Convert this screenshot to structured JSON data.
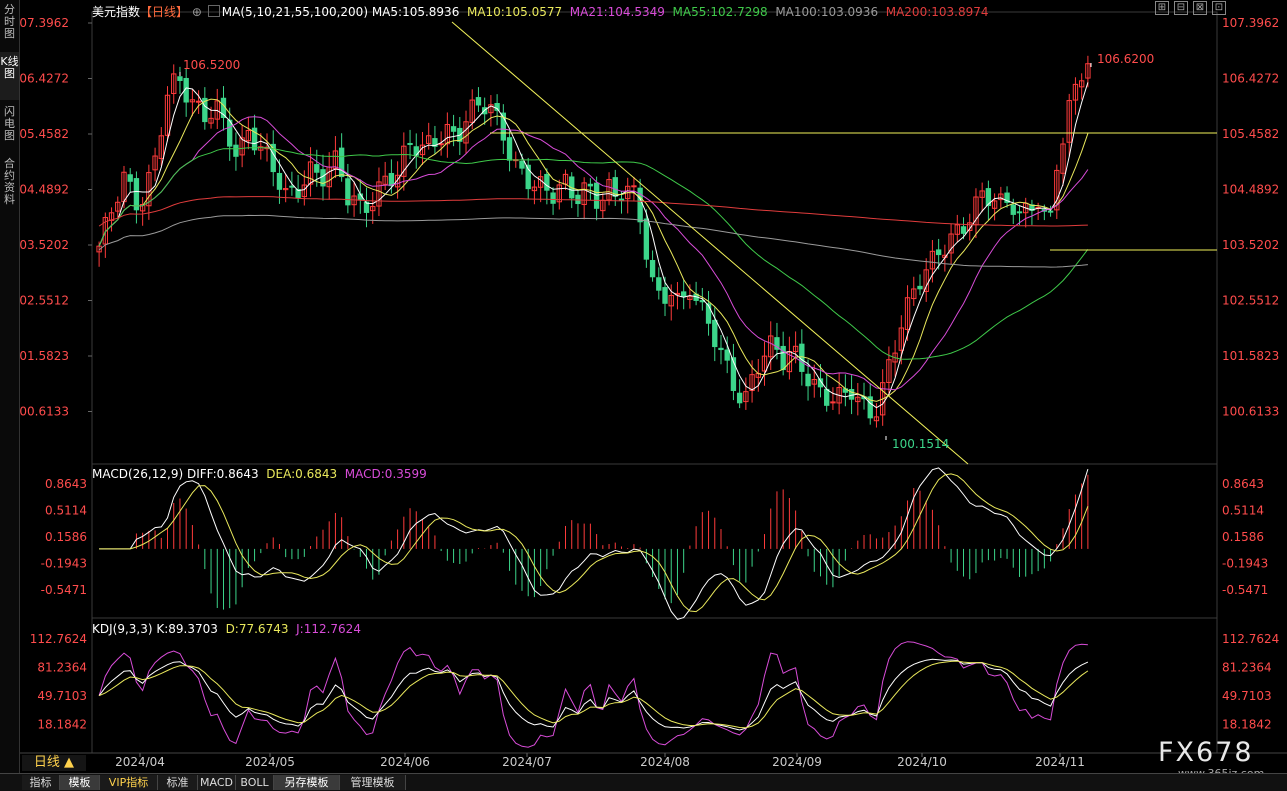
{
  "sidebar": {
    "tabs": [
      {
        "label": "分时图",
        "active": false
      },
      {
        "label": "K线图",
        "active": true
      },
      {
        "label": "闪电图",
        "active": false
      },
      {
        "label": "合约资料",
        "active": false
      }
    ]
  },
  "header": {
    "symbol": "美元指数",
    "period": "【日线】",
    "ma_params": "MA(5,10,21,55,100,200)",
    "ma5": "MA5:105.8936",
    "ma10": "MA10:105.0577",
    "ma21": "MA21:104.5349",
    "ma55": "MA55:102.7298",
    "ma100": "MA100:103.0936",
    "ma200": "MA200:103.8974"
  },
  "colors": {
    "up": "#ff3b3b",
    "down": "#3cd58a",
    "ma5": "#ffffff",
    "ma10": "#e9e85c",
    "ma21": "#d84cd8",
    "ma55": "#3fc94a",
    "ma100": "#9a9a9a",
    "ma200": "#e03c3c",
    "axis_text": "#ff4c4c",
    "trendline": "#f2f25a"
  },
  "price_axis": {
    "ticks": [
      "107.3962",
      "106.4272",
      "105.4582",
      "104.4892",
      "103.5202",
      "102.5512",
      "101.5823",
      "100.6133"
    ]
  },
  "annotations": {
    "high_left": "106.5200",
    "high_right": "106.6200",
    "low": "100.1514"
  },
  "macd": {
    "label": "MACD(26,12,9)",
    "diff": "DIFF:0.8643",
    "dea": "DEA:0.6843",
    "macd": "MACD:0.3599",
    "ticks": [
      "0.8643",
      "0.5114",
      "0.1586",
      "-0.1943",
      "-0.5471"
    ]
  },
  "kdj": {
    "label": "KDJ(9,3,3)",
    "k": "K:89.3703",
    "d": "D:77.6743",
    "j": "J:112.7624",
    "ticks": [
      "112.7624",
      "81.2364",
      "49.7103",
      "18.1842"
    ]
  },
  "x_axis": {
    "period_button": "日线 ▲",
    "months": [
      "2024/04",
      "2024/05",
      "2024/06",
      "2024/07",
      "2024/08",
      "2024/09",
      "2024/10",
      "2024/11"
    ]
  },
  "bottom_tabs": [
    "指标",
    "模板",
    "VIP指标",
    "标准",
    "MACD",
    "BOLL",
    "另存模板",
    "管理模板"
  ],
  "window_controls": [
    "⊞",
    "⊟",
    "⊠",
    "⊡"
  ],
  "watermark": {
    "brand": "FX678",
    "url": "www.365jz.com"
  }
}
